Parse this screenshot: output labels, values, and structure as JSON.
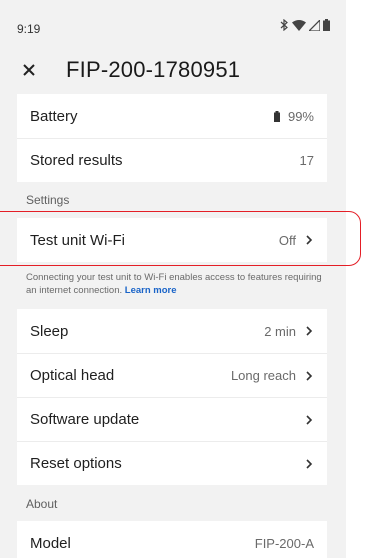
{
  "status_bar": {
    "time": "9:19"
  },
  "app_bar": {
    "title": "FIP-200-1780951"
  },
  "info": {
    "battery": {
      "label": "Battery",
      "value": "99%"
    },
    "stored": {
      "label": "Stored results",
      "value": "17"
    }
  },
  "settings": {
    "header": "Settings",
    "wifi": {
      "label": "Test unit Wi-Fi",
      "value": "Off"
    },
    "hint_text": "Connecting your test unit to Wi-Fi enables access to features requiring an internet connection.",
    "hint_link": "Learn more",
    "sleep": {
      "label": "Sleep",
      "value": "2 min"
    },
    "optical": {
      "label": "Optical head",
      "value": "Long reach"
    },
    "software": {
      "label": "Software update"
    },
    "reset": {
      "label": "Reset options"
    }
  },
  "about": {
    "header": "About",
    "model": {
      "label": "Model",
      "value": "FIP-200-A"
    }
  },
  "colors": {
    "highlight": "#e41e26",
    "link": "#1a64c8",
    "background": "#f2f2f2"
  },
  "icons": [
    "bluetooth-icon",
    "wifi-icon",
    "cellular-icon",
    "battery-icon",
    "close-icon",
    "chevron-right-icon"
  ]
}
